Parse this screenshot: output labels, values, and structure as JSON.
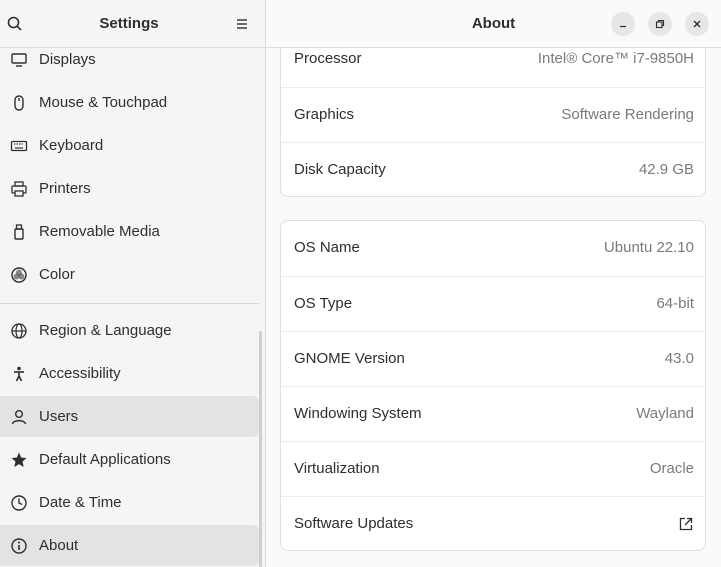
{
  "sidebar": {
    "title": "Settings",
    "items": [
      {
        "label": "Displays",
        "icon": "display-icon"
      },
      {
        "label": "Mouse & Touchpad",
        "icon": "mouse-icon"
      },
      {
        "label": "Keyboard",
        "icon": "keyboard-icon"
      },
      {
        "label": "Printers",
        "icon": "printer-icon"
      },
      {
        "label": "Removable Media",
        "icon": "removable-media-icon"
      },
      {
        "label": "Color",
        "icon": "color-icon"
      },
      {
        "label": "Region & Language",
        "icon": "globe-icon"
      },
      {
        "label": "Accessibility",
        "icon": "accessibility-icon"
      },
      {
        "label": "Users",
        "icon": "users-icon"
      },
      {
        "label": "Default Applications",
        "icon": "star-icon"
      },
      {
        "label": "Date & Time",
        "icon": "clock-icon"
      },
      {
        "label": "About",
        "icon": "info-icon",
        "selected": true
      }
    ]
  },
  "main": {
    "title": "About",
    "hardware": [
      {
        "key": "Processor",
        "value": "Intel® Core™ i7-9850H"
      },
      {
        "key": "Graphics",
        "value": "Software Rendering"
      },
      {
        "key": "Disk Capacity",
        "value": "42.9 GB"
      }
    ],
    "software": [
      {
        "key": "OS Name",
        "value": "Ubuntu 22.10"
      },
      {
        "key": "OS Type",
        "value": "64-bit"
      },
      {
        "key": "GNOME Version",
        "value": "43.0"
      },
      {
        "key": "Windowing System",
        "value": "Wayland"
      },
      {
        "key": "Virtualization",
        "value": "Oracle"
      },
      {
        "key": "Software Updates",
        "value": "",
        "icon": "external-link-icon"
      }
    ]
  },
  "colors": {
    "selected_bg": "#e3e3e3",
    "value_text": "#7a7a7a"
  }
}
